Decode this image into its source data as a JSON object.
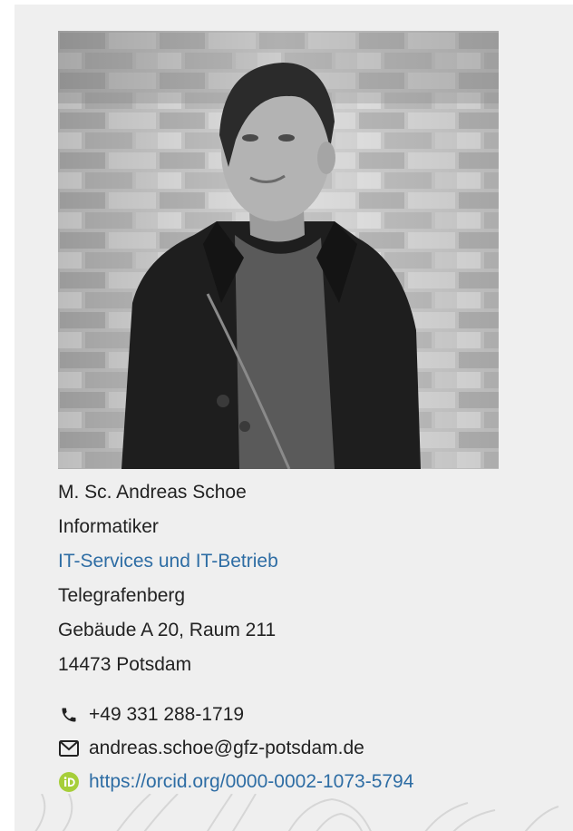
{
  "profile": {
    "photo_alt": "",
    "name": "M. Sc. Andreas Schoe",
    "title": "Informatiker",
    "department": "IT-Services und IT-Betrieb",
    "street": "Telegrafenberg",
    "building": "Gebäude A 20, Raum 211",
    "city": "14473 Potsdam"
  },
  "contact": {
    "phone": "+49 331 288-1719",
    "email": "andreas.schoe@gfz-potsdam.de",
    "orcid": "https://orcid.org/0000-0002-1073-5794"
  },
  "icons": {
    "phone": "phone-icon",
    "email": "envelope-icon",
    "orcid": "orcid-icon"
  },
  "colors": {
    "card_background": "#efefef",
    "link": "#2e6da4",
    "text": "#222222",
    "orcid_green": "#a6ce39"
  }
}
